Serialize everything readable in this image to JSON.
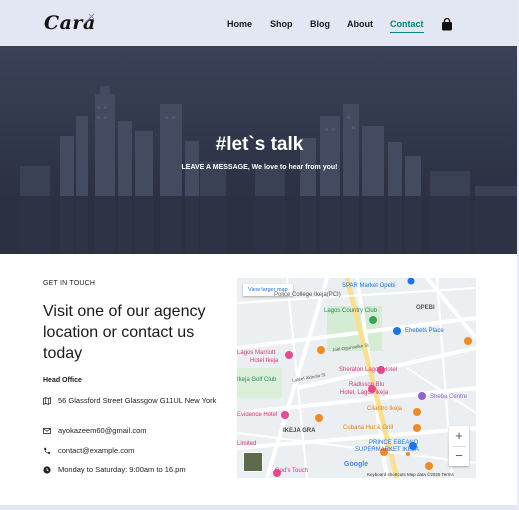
{
  "brand": {
    "logo_text": "Cara"
  },
  "nav": {
    "items": [
      {
        "label": "Home",
        "active": false
      },
      {
        "label": "Shop",
        "active": false
      },
      {
        "label": "Blog",
        "active": false
      },
      {
        "label": "About",
        "active": false
      },
      {
        "label": "Contact",
        "active": true
      }
    ],
    "cart_icon": "shopping-bag-icon",
    "accent": "#088178"
  },
  "hero": {
    "title": "#let`s talk",
    "subtitle": "LEAVE A MESSAGE, We love to hear from you!"
  },
  "contact": {
    "eyebrow": "GET IN TOUCH",
    "headline": "Visit one of our agency location or contact us today",
    "office_label": "Head Office",
    "details": [
      {
        "icon": "map-icon",
        "text": "56 Glassford Street Glassgow G11UL New York"
      },
      {
        "icon": "envelope-icon",
        "text": "ayokazeem60@gmail.com"
      },
      {
        "icon": "phone-icon",
        "text": "contact@example.com"
      },
      {
        "icon": "clock-icon",
        "text": "Monday to Saturday: 9:00am to 16.pm"
      }
    ]
  },
  "map": {
    "larger_map_label": "View larger map",
    "labels": {
      "spar": "SPAR Market Opebi",
      "police": "Police College Ikeja(PCI)",
      "opebi": "OPEBI",
      "country_club": "Lagos Country Club",
      "ehebets": "Ehebets Place",
      "marriott_1": "Lagos Marriott",
      "marriott_2": "Hotel Ikeja",
      "joel": "Joel Ogunnaike St",
      "sheraton": "Sheraton Lagos Hotel",
      "golf": "Ikeja Golf Club",
      "lateef": "Lateef Akinola St",
      "radisson_1": "Radisson Blu",
      "radisson_2": "Hotel, Lagos Ikeja",
      "sheba": "Sheba Centre",
      "evidence": "Evidence Hotel",
      "cilantro": "Cilantro Ikeja",
      "ikeja_gra": "IKEJA GRA",
      "cubana": "Cubana Hut & Grill",
      "prince_1": "PRINCE EBEANO",
      "prince_2": "SUPERMARKET IKEJA",
      "limited": "Limited",
      "gods_touch": "God's Touch",
      "google": "Google",
      "zoom_in": "+",
      "zoom_out": "−",
      "footer": "Keyboard shortcuts    Map data ©2025    Terms"
    }
  }
}
